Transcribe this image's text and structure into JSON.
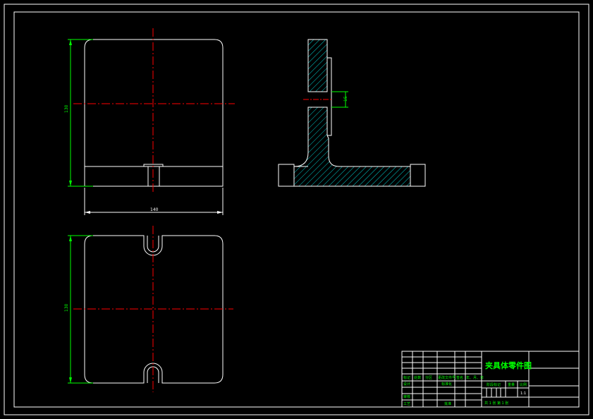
{
  "colors": {
    "background": "#000000",
    "outline": "#ffffff",
    "centerline": "#ff0000",
    "dimension": "#00ff00",
    "hatch": "#00ffff",
    "title_text": "#00ff00"
  },
  "title_block": {
    "drawing_title": "夹具体零件图",
    "scale_row_left": "标记",
    "scale_row_mid1": "处数",
    "scale_row_mid2": "分区",
    "scale_row_mid3": "更改文件号",
    "scale_row_mid4": "签名",
    "scale_row_mid5": "年、月、日",
    "design_label": "设计",
    "standard_label": "标准化",
    "stage_label": "阶段标记",
    "weight_label": "重量",
    "ratio_label": "比例",
    "ratio_value": "1:1",
    "review_label": "审核",
    "process_label": "工艺",
    "approve_label": "批准",
    "sheet_info": "共 1 张  第 1 张"
  },
  "dimensions": {
    "top_view_height": "130",
    "top_view_width": "140",
    "side_view_slot": "15",
    "bottom_view_height": "130"
  }
}
